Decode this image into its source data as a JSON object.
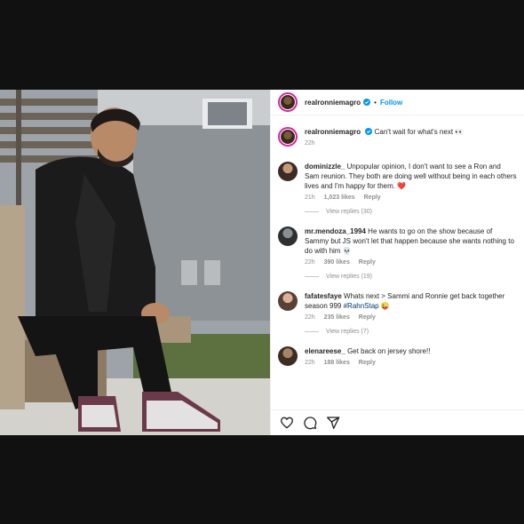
{
  "post": {
    "username": "realronniemagro",
    "follow_label": "Follow",
    "separator": "•",
    "caption": "Can't wait for what's next 👀",
    "caption_time": "22h"
  },
  "comments": [
    {
      "username": "dominizzle_",
      "text": "Unpopular opinion, I don't want to see a Ron and Sam reunion. They both are doing well without being in each others lives and I'm happy for them. ❤️",
      "time": "21h",
      "likes": "1,023 likes",
      "reply_label": "Reply",
      "view_replies": "View replies (30)"
    },
    {
      "username": "mr.mendoza_1994",
      "text": "He wants to go on the show because of Sammy but JS won't let that happen because she wants nothing to do with him 💀",
      "time": "22h",
      "likes": "390 likes",
      "reply_label": "Reply",
      "view_replies": "View replies (19)"
    },
    {
      "username": "fafatesfaye",
      "text_before": "Whats next > Sammi and Ronnie get back together season 999 ",
      "hashtag": "#RahnStap",
      "emoji": " 😜",
      "time": "22h",
      "likes": "235 likes",
      "reply_label": "Reply",
      "view_replies": "View replies (7)"
    },
    {
      "username": "elenareese_",
      "text": "Get back on jersey shore!!",
      "time": "22h",
      "likes": "188 likes",
      "reply_label": "Reply"
    }
  ],
  "icons": [
    "like-heart-icon",
    "comment-bubble-icon",
    "share-plane-icon",
    "verified-badge-icon"
  ],
  "colors": {
    "link_blue": "#0095f6",
    "hashtag": "#00376b",
    "muted": "#8e8e8e",
    "heart": "#ed4956"
  }
}
